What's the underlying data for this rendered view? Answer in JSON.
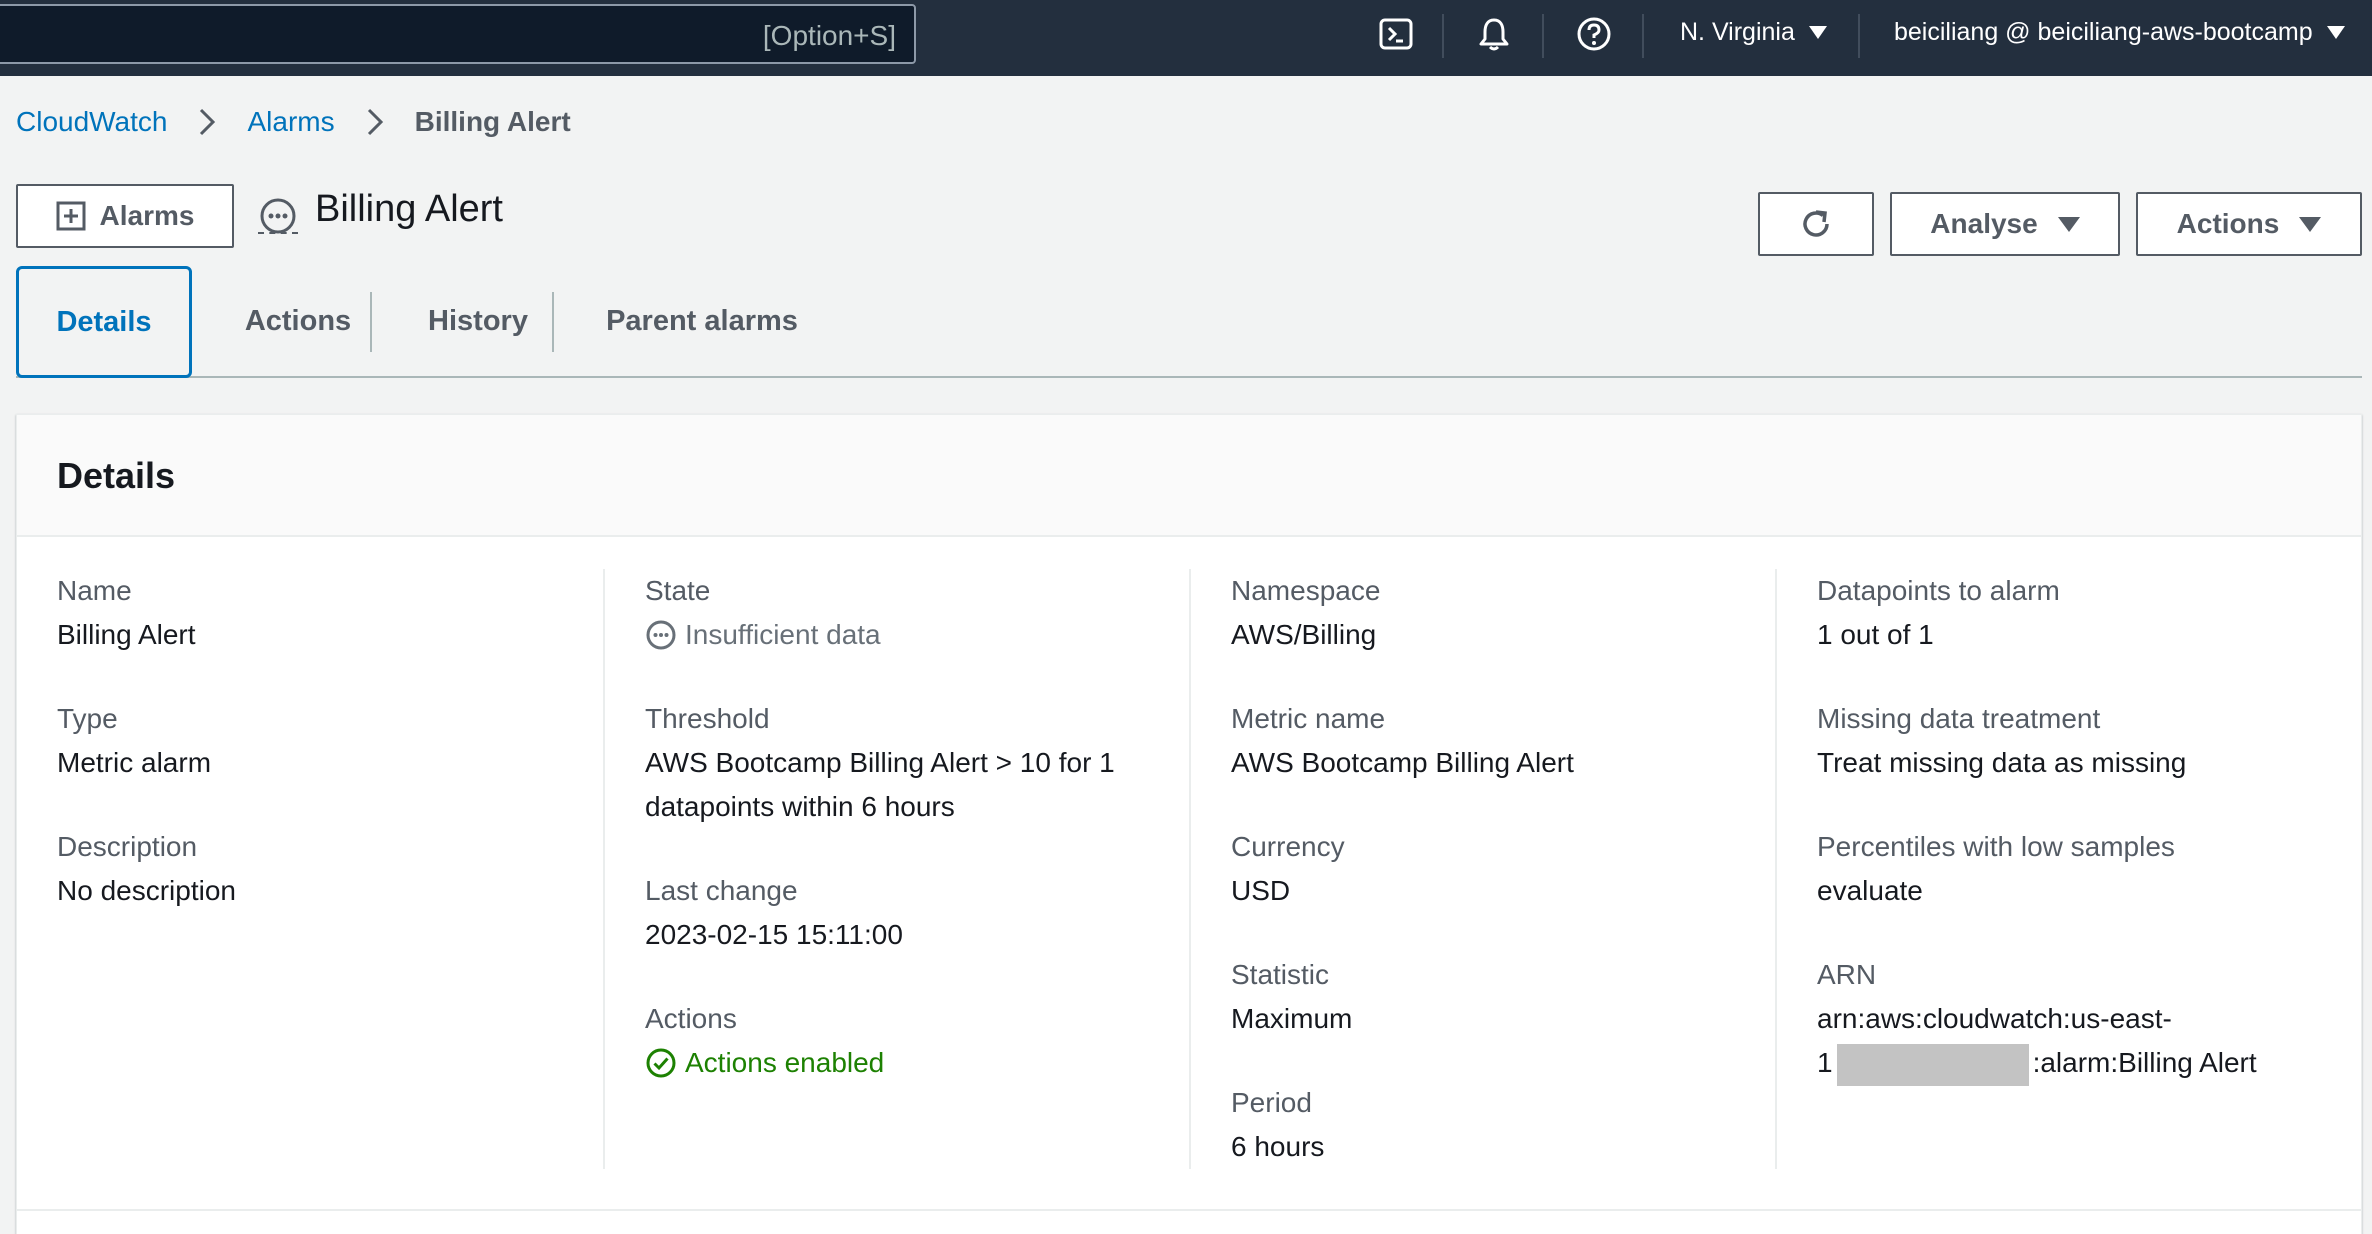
{
  "topnav": {
    "search_shortcut": "[Option+S]",
    "region": "N. Virginia",
    "account": "beiciliang @ beiciliang-aws-bootcamp",
    "icons": [
      "cloudshell-icon",
      "notifications-icon",
      "help-icon"
    ],
    "bg_color": "#232f3e"
  },
  "breadcrumb": {
    "items": [
      "CloudWatch",
      "Alarms"
    ],
    "current": "Billing Alert"
  },
  "header": {
    "back_button": "Alarms",
    "title": "Billing Alert",
    "state_icon": "insufficient-data-icon",
    "buttons": {
      "refresh_icon": "refresh-icon",
      "analyse": "Analyse",
      "actions": "Actions"
    }
  },
  "tabs": {
    "items": [
      "Details",
      "Actions",
      "History",
      "Parent alarms"
    ],
    "active": "Details"
  },
  "details": {
    "title": "Details",
    "col1": {
      "name_label": "Name",
      "name_value": "Billing Alert",
      "type_label": "Type",
      "type_value": "Metric alarm",
      "description_label": "Description",
      "description_value": "No description"
    },
    "col2": {
      "state_label": "State",
      "state_value": "Insufficient data",
      "threshold_label": "Threshold",
      "threshold_value": "AWS Bootcamp Billing Alert > 10 for 1 datapoints within 6 hours",
      "last_change_label": "Last change",
      "last_change_value": "2023-02-15 15:11:00",
      "actions_label": "Actions",
      "actions_value": "Actions enabled"
    },
    "col3": {
      "namespace_label": "Namespace",
      "namespace_value": "AWS/Billing",
      "metric_label": "Metric name",
      "metric_value": "AWS Bootcamp Billing Alert",
      "currency_label": "Currency",
      "currency_value": "USD",
      "statistic_label": "Statistic",
      "statistic_value": "Maximum",
      "period_label": "Period",
      "period_value": "6 hours"
    },
    "col4": {
      "datapoints_label": "Datapoints to alarm",
      "datapoints_value": "1 out of 1",
      "missing_label": "Missing data treatment",
      "missing_value": "Treat missing data as missing",
      "percentiles_label": "Percentiles with low samples",
      "percentiles_value": "evaluate",
      "arn_label": "ARN",
      "arn_part1": "arn:aws:cloudwatch:us-east-",
      "arn_part2": "1",
      "arn_part3": ":alarm:Billing Alert"
    }
  },
  "colors": {
    "link": "#0073bb",
    "success": "#1d8102",
    "muted": "#687078"
  }
}
